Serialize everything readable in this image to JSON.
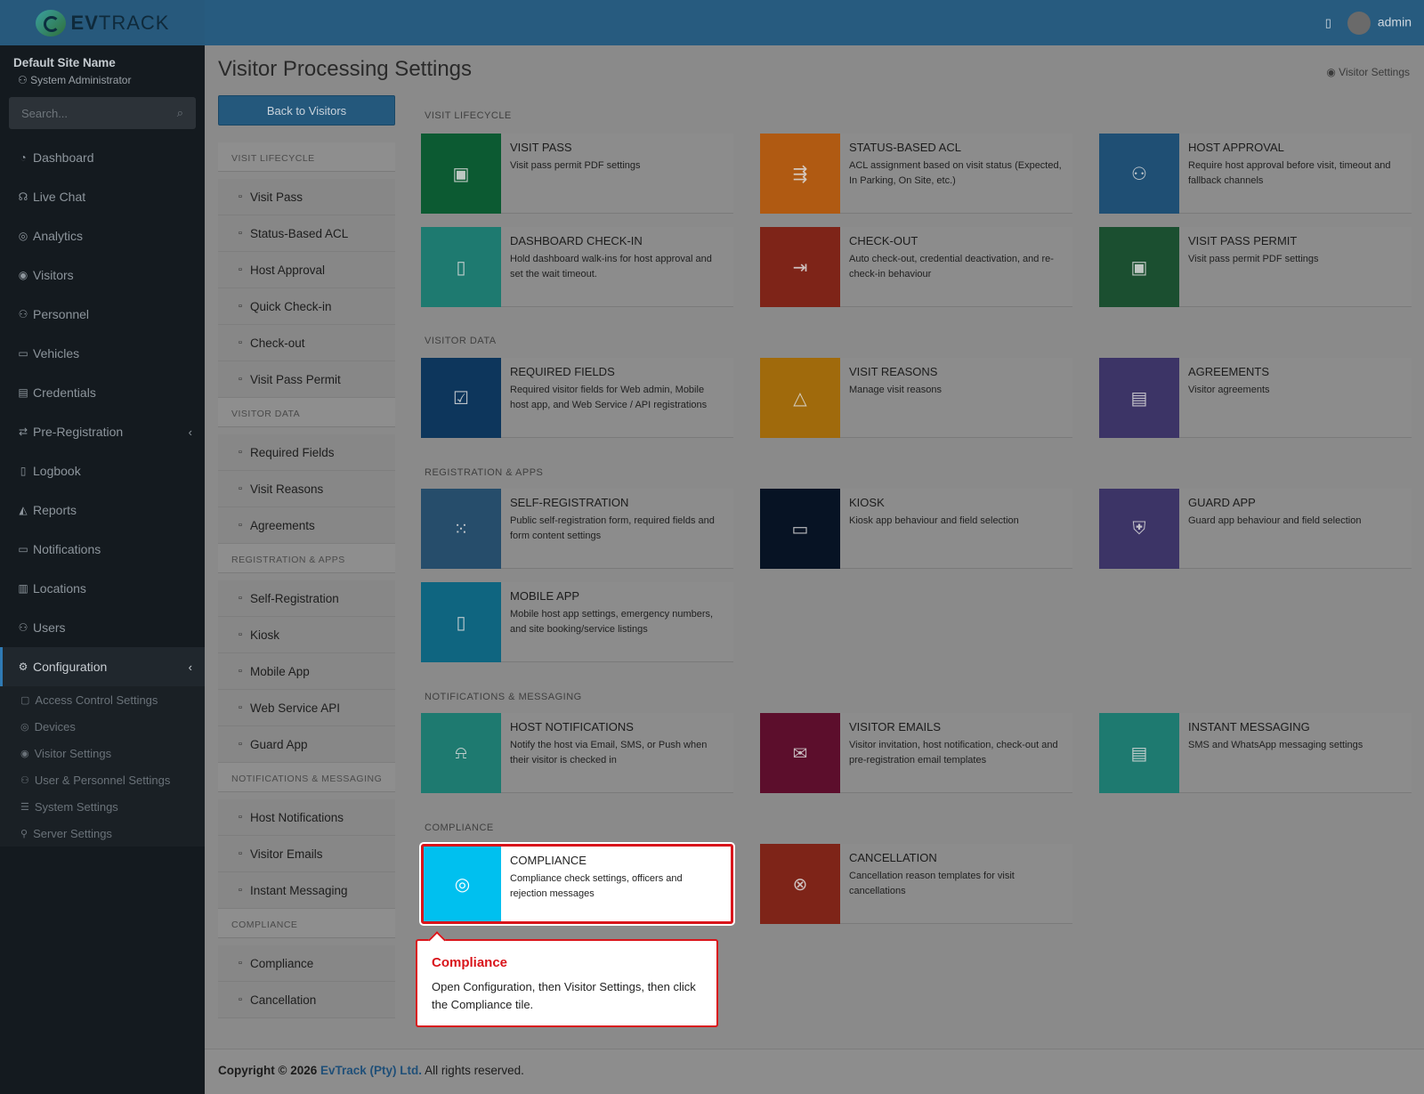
{
  "topbar": {
    "logo_text_bold": "EV",
    "logo_text_light": "TRACK",
    "user": "admin"
  },
  "sidebar": {
    "site_name": "Default Site Name",
    "role": "System Administrator",
    "search_placeholder": "Search...",
    "items": [
      {
        "label": "Dashboard",
        "icon": "dashboard-icon"
      },
      {
        "label": "Live Chat",
        "icon": "headset-icon"
      },
      {
        "label": "Analytics",
        "icon": "analytics-icon"
      },
      {
        "label": "Visitors",
        "icon": "eye-icon"
      },
      {
        "label": "Personnel",
        "icon": "personnel-icon"
      },
      {
        "label": "Vehicles",
        "icon": "car-icon"
      },
      {
        "label": "Credentials",
        "icon": "id-card-icon"
      },
      {
        "label": "Pre-Registration",
        "icon": "exchange-icon"
      },
      {
        "label": "Logbook",
        "icon": "book-icon"
      },
      {
        "label": "Reports",
        "icon": "chart-icon"
      },
      {
        "label": "Notifications",
        "icon": "bell-icon"
      },
      {
        "label": "Locations",
        "icon": "map-icon"
      },
      {
        "label": "Users",
        "icon": "users-icon"
      },
      {
        "label": "Configuration",
        "icon": "gear-icon"
      }
    ],
    "config_sub": [
      "Access Control Settings",
      "Devices",
      "Visitor Settings",
      "User & Personnel Settings",
      "System Settings",
      "Server Settings"
    ]
  },
  "main": {
    "title": "Visitor Processing Settings",
    "breadcrumb": "Visitor Settings",
    "back_button": "Back to Visitors"
  },
  "leftnav": {
    "visit_lifecycle": "VISIT LIFECYCLE",
    "visit_lifecycle_items": [
      "Visit Pass",
      "Status-Based ACL",
      "Host Approval",
      "Quick Check-in",
      "Check-out",
      "Visit Pass Permit"
    ],
    "visitor_data": "VISITOR DATA",
    "visitor_data_items": [
      "Required Fields",
      "Visit Reasons",
      "Agreements"
    ],
    "registration_apps": "REGISTRATION & APPS",
    "registration_apps_items": [
      "Self-Registration",
      "Kiosk",
      "Mobile App",
      "Web Service API",
      "Guard App"
    ],
    "notifications": "NOTIFICATIONS & MESSAGING",
    "notifications_items": [
      "Host Notifications",
      "Visitor Emails",
      "Instant Messaging"
    ],
    "compliance": "COMPLIANCE",
    "compliance_items": [
      "Compliance",
      "Cancellation"
    ]
  },
  "sections": {
    "visit_lifecycle": "VISIT LIFECYCLE",
    "visitor_data": "VISITOR DATA",
    "registration_apps": "REGISTRATION & APPS",
    "notifications": "NOTIFICATIONS & MESSAGING",
    "compliance": "COMPLIANCE"
  },
  "tiles": {
    "visit_pass": {
      "title": "VISIT PASS",
      "desc": "Visit pass permit PDF settings",
      "color": "#0c5a32"
    },
    "status_acl": {
      "title": "STATUS-BASED ACL",
      "desc": "ACL assignment based on visit status (Expected, In Parking, On Site, etc.)",
      "color": "#b05a12"
    },
    "host_approval": {
      "title": "HOST APPROVAL",
      "desc": "Require host approval before visit, timeout and fallback channels",
      "color": "#1f4f74"
    },
    "dashboard_checkin": {
      "title": "DASHBOARD CHECK-IN",
      "desc": "Hold dashboard walk-ins for host approval and set the wait timeout.",
      "color": "#1e7a70"
    },
    "checkout": {
      "title": "CHECK-OUT",
      "desc": "Auto check-out, credential deactivation, and re-check-in behaviour",
      "color": "#7e2418"
    },
    "visit_pass_permit": {
      "title": "VISIT PASS PERMIT",
      "desc": "Visit pass permit PDF settings",
      "color": "#1b4f30"
    },
    "required_fields": {
      "title": "REQUIRED FIELDS",
      "desc": "Required visitor fields for Web admin, Mobile host app, and Web Service / API registrations",
      "color": "#0d365c"
    },
    "visit_reasons": {
      "title": "VISIT REASONS",
      "desc": "Manage visit reasons",
      "color": "#a06a0c"
    },
    "agreements": {
      "title": "AGREEMENTS",
      "desc": "Visitor agreements",
      "color": "#3c3466"
    },
    "self_registration": {
      "title": "SELF-REGISTRATION",
      "desc": "Public self-registration form, required fields and form content settings",
      "color": "#264d6b"
    },
    "kiosk": {
      "title": "KIOSK",
      "desc": "Kiosk app behaviour and field selection",
      "color": "#071324"
    },
    "guard_app": {
      "title": "GUARD APP",
      "desc": "Guard app behaviour and field selection",
      "color": "#3c3466"
    },
    "mobile_app": {
      "title": "MOBILE APP",
      "desc": "Mobile host app settings, emergency numbers, and site booking/service listings",
      "color": "#0f6580"
    },
    "host_notifications": {
      "title": "HOST NOTIFICATIONS",
      "desc": "Notify the host via Email, SMS, or Push when their visitor is checked in",
      "color": "#1e7a70"
    },
    "visitor_emails": {
      "title": "VISITOR EMAILS",
      "desc": "Visitor invitation, host notification, check-out and pre-registration email templates",
      "color": "#5c0e2c"
    },
    "instant_messaging": {
      "title": "INSTANT MESSAGING",
      "desc": "SMS and WhatsApp messaging settings",
      "color": "#1e7a70"
    },
    "compliance": {
      "title": "COMPLIANCE",
      "desc": "Compliance check settings, officers and rejection messages",
      "color": "#00c0ef"
    },
    "cancellation": {
      "title": "CANCELLATION",
      "desc": "Cancellation reason templates for visit cancellations",
      "color": "#7e2418"
    }
  },
  "tooltip": {
    "title": "Compliance",
    "body": "Open Configuration, then Visitor Settings, then click the Compliance tile."
  },
  "footer": {
    "copyright": "Copyright © 2026",
    "brand": "EvTrack (Pty) Ltd.",
    "rights": "All rights reserved."
  }
}
